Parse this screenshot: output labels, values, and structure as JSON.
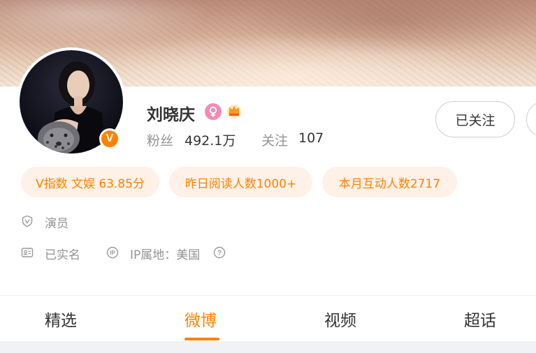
{
  "profile": {
    "name": "刘晓庆",
    "verified_badge": "V",
    "stats": {
      "fans_label": "粉丝",
      "fans_value": "492.1万",
      "follow_label": "关注",
      "follow_value": "107"
    },
    "follow_button_label": "已关注",
    "icons": {
      "gender": "female-icon",
      "member": "crown-icon"
    }
  },
  "tags": [
    "V指数 文娱 63.85分",
    "昨日阅读人数1000+",
    "本月互动人数2717"
  ],
  "info": {
    "occupation": "演员",
    "real_name": "已实名",
    "ip_location": "IP属地：美国"
  },
  "tabs": [
    {
      "label": "精选",
      "active": false
    },
    {
      "label": "微博",
      "active": true
    },
    {
      "label": "视频",
      "active": false
    },
    {
      "label": "超话",
      "active": false
    }
  ],
  "colors": {
    "accent": "#ff8200",
    "tag_bg": "#fff1e8",
    "muted_text": "#939393",
    "gender_pink": "#f28bb3"
  }
}
